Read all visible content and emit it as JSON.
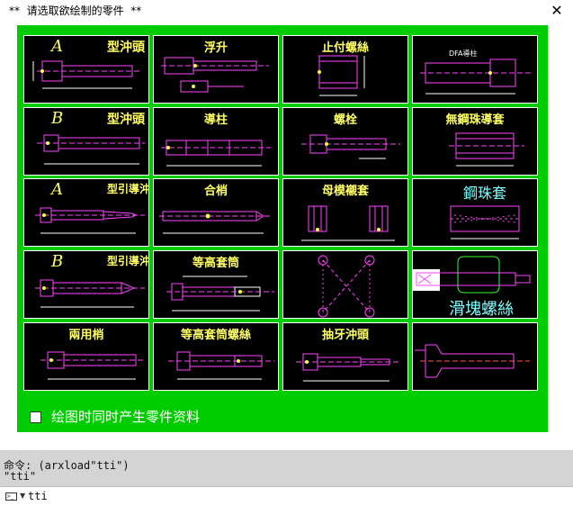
{
  "window": {
    "title": "**  请选取欲绘制的零件  **",
    "close_glyph": "✕"
  },
  "tiles": [
    {
      "id": "a-punch",
      "letter": "A",
      "label": "型沖頭",
      "label_color": "yellow"
    },
    {
      "id": "float",
      "letter": "",
      "label": "浮升",
      "label_color": "yellow"
    },
    {
      "id": "stop-screw",
      "letter": "",
      "label": "止付螺絲",
      "label_color": "yellow"
    },
    {
      "id": "dfa-guide",
      "letter": "",
      "label": "DFA導柱",
      "label_color": "small"
    },
    {
      "id": "b-punch",
      "letter": "B",
      "label": "型沖頭",
      "label_color": "yellow"
    },
    {
      "id": "guide-post",
      "letter": "",
      "label": "導柱",
      "label_color": "yellow"
    },
    {
      "id": "bolt",
      "letter": "",
      "label": "螺栓",
      "label_color": "yellow"
    },
    {
      "id": "ballless-bush",
      "letter": "",
      "label": "無鋼珠導套",
      "label_color": "yellow"
    },
    {
      "id": "a-pilot",
      "letter": "A",
      "label": "型引導沖",
      "label_color": "yellow"
    },
    {
      "id": "dowel",
      "letter": "",
      "label": "合梢",
      "label_color": "yellow"
    },
    {
      "id": "female-bush",
      "letter": "",
      "label": "母模襯套",
      "label_color": "yellow"
    },
    {
      "id": "ball-bush",
      "letter": "",
      "label": "鋼珠套",
      "label_color": "cyan"
    },
    {
      "id": "b-pilot",
      "letter": "B",
      "label": "型引導沖",
      "label_color": "yellow"
    },
    {
      "id": "equal-sleeve",
      "letter": "",
      "label": "等高套筒",
      "label_color": "yellow"
    },
    {
      "id": "x-link",
      "letter": "",
      "label": "",
      "label_color": "yellow"
    },
    {
      "id": "slide-screw",
      "letter": "",
      "label": "滑塊螺絲",
      "label_color": "cyan"
    },
    {
      "id": "two-use-pin",
      "letter": "",
      "label": "兩用梢",
      "label_color": "yellow"
    },
    {
      "id": "equal-sleeve-screw",
      "letter": "",
      "label": "等高套筒螺絲",
      "label_color": "yellow"
    },
    {
      "id": "tap-punch",
      "letter": "",
      "label": "抽牙沖頭",
      "label_color": "yellow"
    },
    {
      "id": "countersunk",
      "letter": "",
      "label": "",
      "label_color": "yellow"
    }
  ],
  "options": {
    "generate_data_label": "绘图时同时产生零件资料",
    "generate_data_checked": false
  },
  "command_area": {
    "line1": "命令: (arxload\"tti\")",
    "line2": "\"tti\""
  },
  "prompt": {
    "value": "tti"
  }
}
